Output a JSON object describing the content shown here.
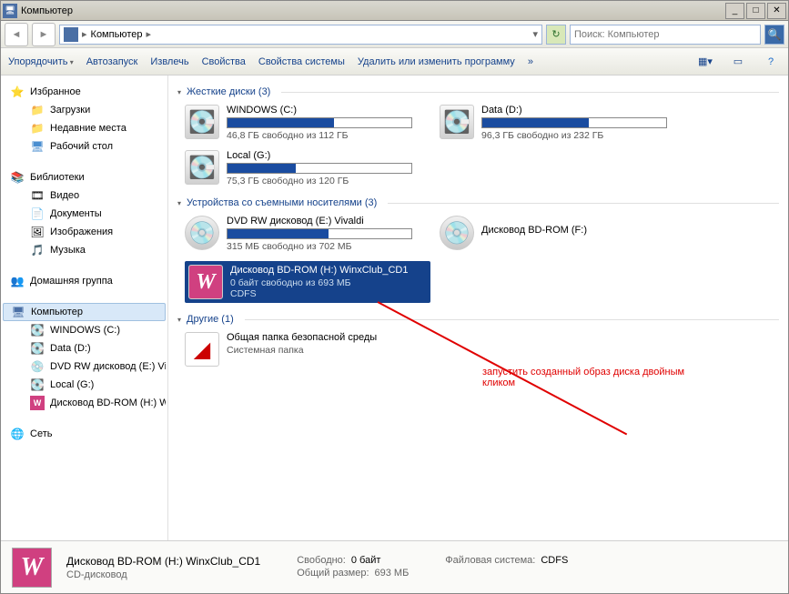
{
  "window": {
    "title": "Компьютер"
  },
  "addr": {
    "label": "Компьютер"
  },
  "search": {
    "placeholder": "Поиск: Компьютер"
  },
  "toolbar": {
    "organize": "Упорядочить",
    "autorun": "Автозапуск",
    "extract": "Извлечь",
    "props": "Свойства",
    "sysprops": "Свойства системы",
    "uninstall": "Удалить или изменить программу",
    "more": "»"
  },
  "sidebar": {
    "fav": {
      "head": "Избранное",
      "items": [
        "Загрузки",
        "Недавние места",
        "Рабочий стол"
      ]
    },
    "lib": {
      "head": "Библиотеки",
      "items": [
        "Видео",
        "Документы",
        "Изображения",
        "Музыка"
      ]
    },
    "homegroup": "Домашняя группа",
    "computer": {
      "head": "Компьютер",
      "items": [
        "WINDOWS (C:)",
        "Data (D:)",
        "DVD RW дисковод (E:) Viv",
        "Local (G:)",
        "Дисковод BD-ROM (H:) Wi"
      ]
    },
    "network": "Сеть"
  },
  "groups": {
    "hdd": {
      "head": "Жесткие диски (3)",
      "drives": [
        {
          "name": "WINDOWS (C:)",
          "free": "46,8 ГБ свободно из 112 ГБ",
          "fill": 58
        },
        {
          "name": "Data (D:)",
          "free": "96,3 ГБ свободно из 232 ГБ",
          "fill": 58
        },
        {
          "name": "Local (G:)",
          "free": "75,3 ГБ свободно из 120 ГБ",
          "fill": 37
        }
      ]
    },
    "removable": {
      "head": "Устройства со съемными носителями (3)",
      "drives": [
        {
          "name": "DVD RW дисковод (E:) Vivaldi",
          "free": "315 МБ свободно из 702 МБ",
          "fill": 55
        },
        {
          "name": "Дисковод BD-ROM (F:)"
        },
        {
          "name": "Дисковод BD-ROM (H:) WinxClub_CD1",
          "free": "0 байт свободно из 693 МБ",
          "fs": "CDFS"
        }
      ]
    },
    "other": {
      "head": "Другие (1)",
      "drives": [
        {
          "name": "Общая папка безопасной среды",
          "sub": "Системная папка"
        }
      ]
    }
  },
  "annotation": {
    "text1": "запустить созданный образ диска двойным",
    "text2": "кликом"
  },
  "status": {
    "title": "Дисковод BD-ROM (H:) WinxClub_CD1",
    "type": "CD-дисковод",
    "free_k": "Свободно:",
    "free_v": "0 байт",
    "size_k": "Общий размер:",
    "size_v": "693 МБ",
    "fs_k": "Файловая система:",
    "fs_v": "CDFS"
  }
}
